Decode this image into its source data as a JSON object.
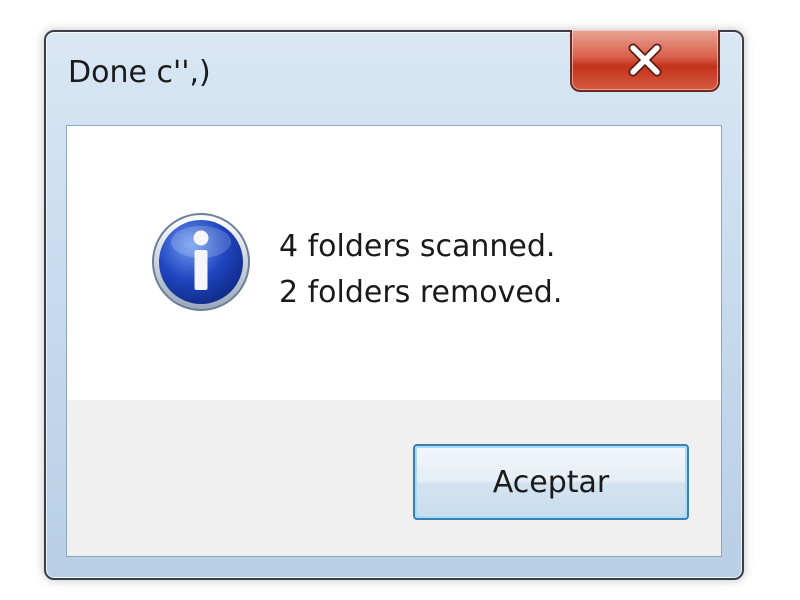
{
  "window": {
    "title": "Done c'',)",
    "close_icon": "close-x-icon"
  },
  "dialog": {
    "icon": "info-icon",
    "message_lines": [
      "4 folders scanned.",
      "2 folders removed."
    ],
    "ok_label": "Aceptar"
  },
  "colors": {
    "close_button": "#c5321c",
    "info_icon_blue": "#1d3fb3",
    "button_focus_border": "#3c7fb1"
  }
}
